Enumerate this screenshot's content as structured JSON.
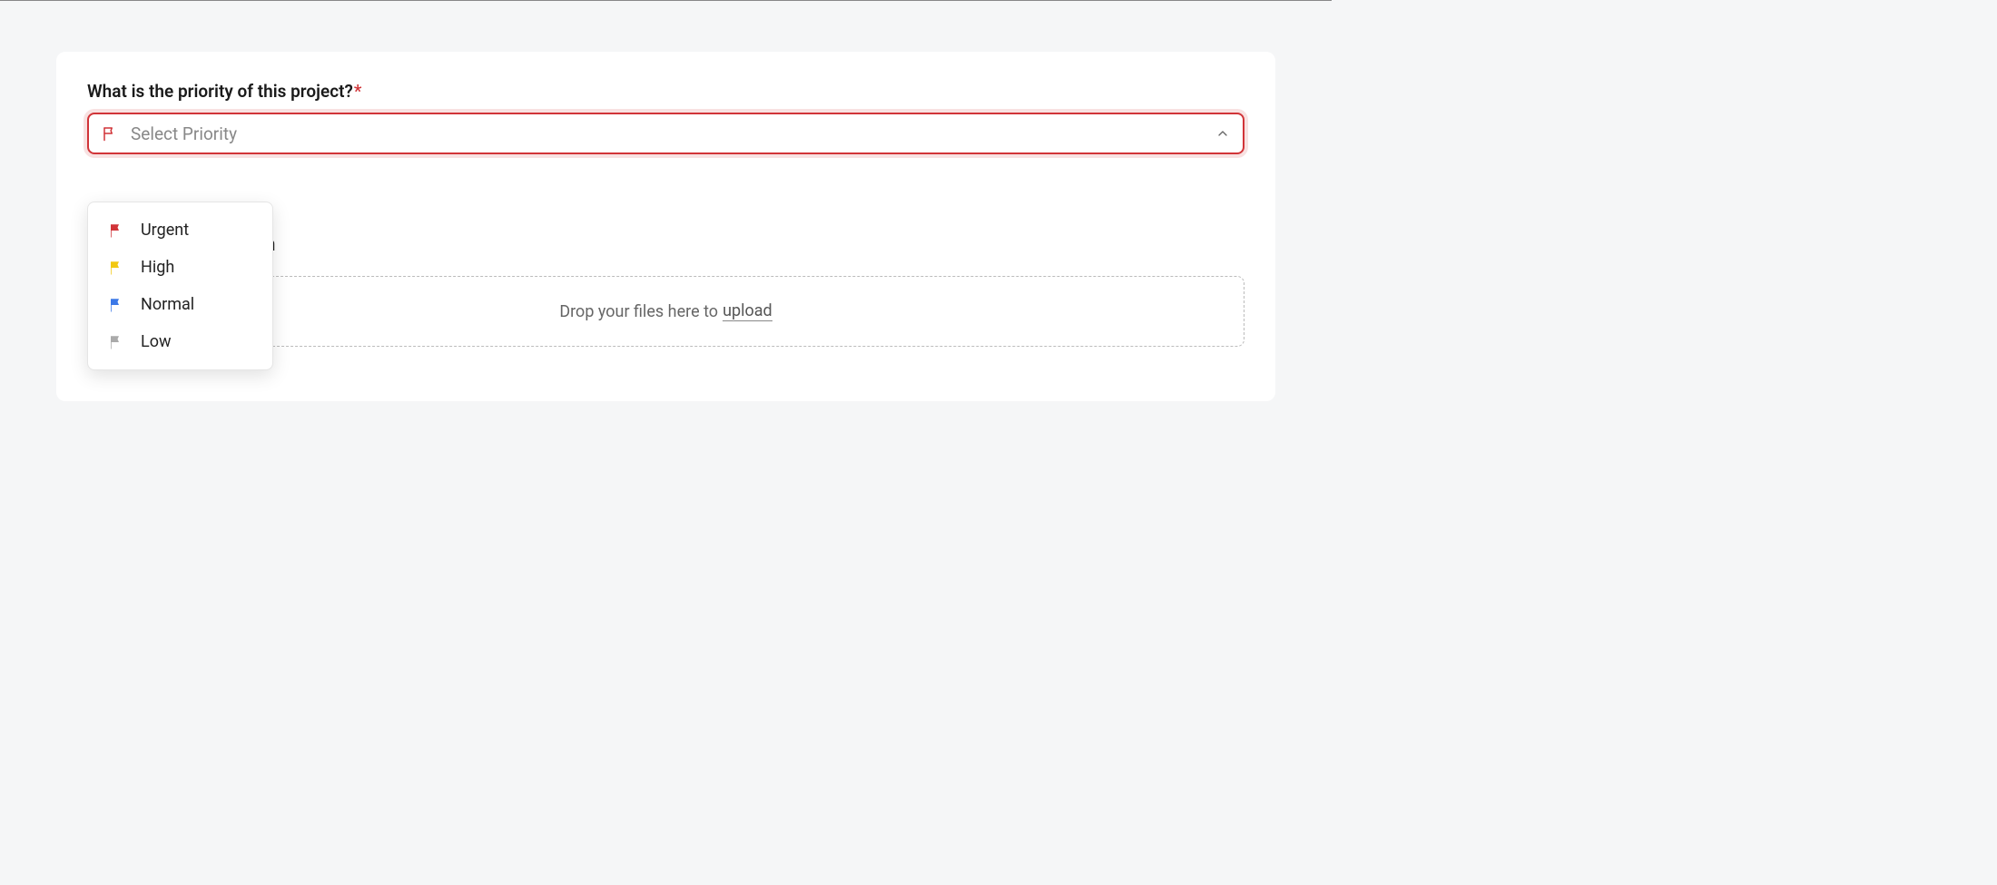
{
  "priority": {
    "label": "What is the priority of this project?",
    "placeholder": "Select Priority",
    "options": [
      {
        "label": "Urgent",
        "color": "#d13438"
      },
      {
        "label": "High",
        "color": "#f2c811"
      },
      {
        "label": "Normal",
        "color": "#3b78e7"
      },
      {
        "label": "Low",
        "color": "#aaaaaa"
      }
    ]
  },
  "attachments": {
    "title_fragment": "nformation",
    "drop_text": "Drop your files here to",
    "upload_text": "upload"
  }
}
